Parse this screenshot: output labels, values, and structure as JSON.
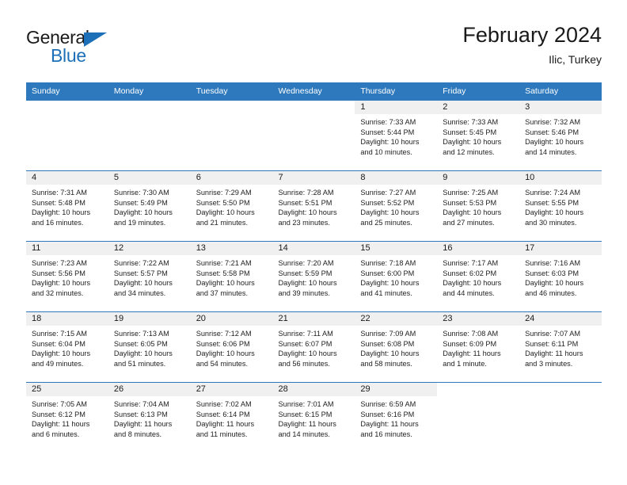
{
  "logo": {
    "word_top": "General",
    "word_bottom": "Blue",
    "flag_icon": "triangle-flag-icon",
    "accent_color": "#1d70b8"
  },
  "header": {
    "title": "February 2024",
    "subtitle": "Ilic, Turkey"
  },
  "theme": {
    "header_blue": "#2e79bd",
    "daynum_band": "#f0f0f0",
    "text": "#1a1a1a"
  },
  "calendar": {
    "weekday_headers": [
      "Sunday",
      "Monday",
      "Tuesday",
      "Wednesday",
      "Thursday",
      "Friday",
      "Saturday"
    ],
    "weeks": [
      [
        {
          "day": "",
          "blank": true
        },
        {
          "day": "",
          "blank": true
        },
        {
          "day": "",
          "blank": true
        },
        {
          "day": "",
          "blank": true
        },
        {
          "day": "1",
          "sunrise": "Sunrise: 7:33 AM",
          "sunset": "Sunset: 5:44 PM",
          "daylight": "Daylight: 10 hours and 10 minutes."
        },
        {
          "day": "2",
          "sunrise": "Sunrise: 7:33 AM",
          "sunset": "Sunset: 5:45 PM",
          "daylight": "Daylight: 10 hours and 12 minutes."
        },
        {
          "day": "3",
          "sunrise": "Sunrise: 7:32 AM",
          "sunset": "Sunset: 5:46 PM",
          "daylight": "Daylight: 10 hours and 14 minutes."
        }
      ],
      [
        {
          "day": "4",
          "sunrise": "Sunrise: 7:31 AM",
          "sunset": "Sunset: 5:48 PM",
          "daylight": "Daylight: 10 hours and 16 minutes."
        },
        {
          "day": "5",
          "sunrise": "Sunrise: 7:30 AM",
          "sunset": "Sunset: 5:49 PM",
          "daylight": "Daylight: 10 hours and 19 minutes."
        },
        {
          "day": "6",
          "sunrise": "Sunrise: 7:29 AM",
          "sunset": "Sunset: 5:50 PM",
          "daylight": "Daylight: 10 hours and 21 minutes."
        },
        {
          "day": "7",
          "sunrise": "Sunrise: 7:28 AM",
          "sunset": "Sunset: 5:51 PM",
          "daylight": "Daylight: 10 hours and 23 minutes."
        },
        {
          "day": "8",
          "sunrise": "Sunrise: 7:27 AM",
          "sunset": "Sunset: 5:52 PM",
          "daylight": "Daylight: 10 hours and 25 minutes."
        },
        {
          "day": "9",
          "sunrise": "Sunrise: 7:25 AM",
          "sunset": "Sunset: 5:53 PM",
          "daylight": "Daylight: 10 hours and 27 minutes."
        },
        {
          "day": "10",
          "sunrise": "Sunrise: 7:24 AM",
          "sunset": "Sunset: 5:55 PM",
          "daylight": "Daylight: 10 hours and 30 minutes."
        }
      ],
      [
        {
          "day": "11",
          "sunrise": "Sunrise: 7:23 AM",
          "sunset": "Sunset: 5:56 PM",
          "daylight": "Daylight: 10 hours and 32 minutes."
        },
        {
          "day": "12",
          "sunrise": "Sunrise: 7:22 AM",
          "sunset": "Sunset: 5:57 PM",
          "daylight": "Daylight: 10 hours and 34 minutes."
        },
        {
          "day": "13",
          "sunrise": "Sunrise: 7:21 AM",
          "sunset": "Sunset: 5:58 PM",
          "daylight": "Daylight: 10 hours and 37 minutes."
        },
        {
          "day": "14",
          "sunrise": "Sunrise: 7:20 AM",
          "sunset": "Sunset: 5:59 PM",
          "daylight": "Daylight: 10 hours and 39 minutes."
        },
        {
          "day": "15",
          "sunrise": "Sunrise: 7:18 AM",
          "sunset": "Sunset: 6:00 PM",
          "daylight": "Daylight: 10 hours and 41 minutes."
        },
        {
          "day": "16",
          "sunrise": "Sunrise: 7:17 AM",
          "sunset": "Sunset: 6:02 PM",
          "daylight": "Daylight: 10 hours and 44 minutes."
        },
        {
          "day": "17",
          "sunrise": "Sunrise: 7:16 AM",
          "sunset": "Sunset: 6:03 PM",
          "daylight": "Daylight: 10 hours and 46 minutes."
        }
      ],
      [
        {
          "day": "18",
          "sunrise": "Sunrise: 7:15 AM",
          "sunset": "Sunset: 6:04 PM",
          "daylight": "Daylight: 10 hours and 49 minutes."
        },
        {
          "day": "19",
          "sunrise": "Sunrise: 7:13 AM",
          "sunset": "Sunset: 6:05 PM",
          "daylight": "Daylight: 10 hours and 51 minutes."
        },
        {
          "day": "20",
          "sunrise": "Sunrise: 7:12 AM",
          "sunset": "Sunset: 6:06 PM",
          "daylight": "Daylight: 10 hours and 54 minutes."
        },
        {
          "day": "21",
          "sunrise": "Sunrise: 7:11 AM",
          "sunset": "Sunset: 6:07 PM",
          "daylight": "Daylight: 10 hours and 56 minutes."
        },
        {
          "day": "22",
          "sunrise": "Sunrise: 7:09 AM",
          "sunset": "Sunset: 6:08 PM",
          "daylight": "Daylight: 10 hours and 58 minutes."
        },
        {
          "day": "23",
          "sunrise": "Sunrise: 7:08 AM",
          "sunset": "Sunset: 6:09 PM",
          "daylight": "Daylight: 11 hours and 1 minute."
        },
        {
          "day": "24",
          "sunrise": "Sunrise: 7:07 AM",
          "sunset": "Sunset: 6:11 PM",
          "daylight": "Daylight: 11 hours and 3 minutes."
        }
      ],
      [
        {
          "day": "25",
          "sunrise": "Sunrise: 7:05 AM",
          "sunset": "Sunset: 6:12 PM",
          "daylight": "Daylight: 11 hours and 6 minutes."
        },
        {
          "day": "26",
          "sunrise": "Sunrise: 7:04 AM",
          "sunset": "Sunset: 6:13 PM",
          "daylight": "Daylight: 11 hours and 8 minutes."
        },
        {
          "day": "27",
          "sunrise": "Sunrise: 7:02 AM",
          "sunset": "Sunset: 6:14 PM",
          "daylight": "Daylight: 11 hours and 11 minutes."
        },
        {
          "day": "28",
          "sunrise": "Sunrise: 7:01 AM",
          "sunset": "Sunset: 6:15 PM",
          "daylight": "Daylight: 11 hours and 14 minutes."
        },
        {
          "day": "29",
          "sunrise": "Sunrise: 6:59 AM",
          "sunset": "Sunset: 6:16 PM",
          "daylight": "Daylight: 11 hours and 16 minutes."
        },
        {
          "day": "",
          "blank": true
        },
        {
          "day": "",
          "blank": true
        }
      ]
    ]
  }
}
